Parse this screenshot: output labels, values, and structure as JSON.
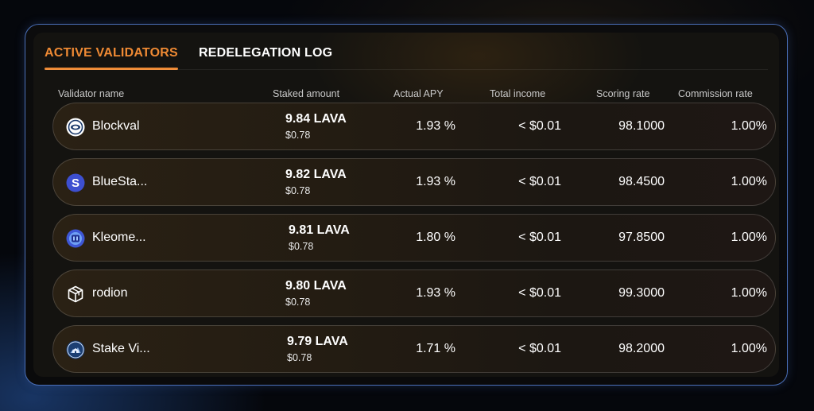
{
  "tabs": [
    {
      "label": "ACTIVE VALIDATORS",
      "active": true
    },
    {
      "label": "REDELEGATION LOG",
      "active": false
    }
  ],
  "columns": {
    "validator": "Validator name",
    "staked": "Staked amount",
    "apy": "Actual APY",
    "income": "Total income",
    "scoring": "Scoring rate",
    "commission": "Commission rate"
  },
  "rows": [
    {
      "name": "Blockval",
      "icon": "blockval-logo-icon",
      "staked": "9.84 LAVA",
      "usd": "$0.78",
      "apy": "1.93 %",
      "income": "< $0.01",
      "scoring": "98.1000",
      "commission": "1.00%"
    },
    {
      "name": "BlueSta...",
      "icon": "bluestake-logo-icon",
      "staked": "9.82 LAVA",
      "usd": "$0.78",
      "apy": "1.93 %",
      "income": "< $0.01",
      "scoring": "98.4500",
      "commission": "1.00%"
    },
    {
      "name": "Kleome...",
      "icon": "kleomedes-logo-icon",
      "staked": "9.81 LAVA",
      "usd": "$0.78",
      "apy": "1.80 %",
      "income": "< $0.01",
      "scoring": "97.8500",
      "commission": "1.00%"
    },
    {
      "name": "rodion",
      "icon": "rodion-cube-logo-icon",
      "staked": "9.80 LAVA",
      "usd": "$0.78",
      "apy": "1.93 %",
      "income": "< $0.01",
      "scoring": "99.3000",
      "commission": "1.00%"
    },
    {
      "name": "Stake Vi...",
      "icon": "stake-village-logo-icon",
      "staked": "9.79 LAVA",
      "usd": "$0.78",
      "apy": "1.71 %",
      "income": "< $0.01",
      "scoring": "98.2000",
      "commission": "1.00%"
    }
  ],
  "colors": {
    "accent": "#ef8a34",
    "panel_border": "#4a6fb8",
    "background": "#05070c"
  }
}
